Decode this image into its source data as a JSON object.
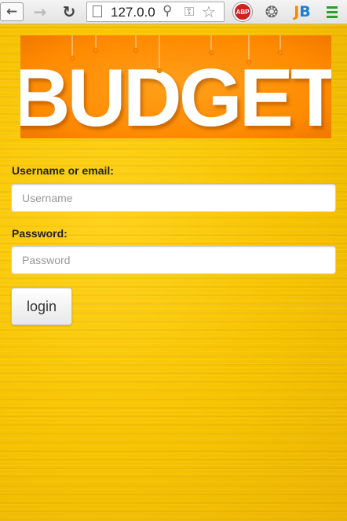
{
  "browser": {
    "url": "127.0.0",
    "extensions": [
      {
        "name": "adblock-plus",
        "label": "ABP"
      },
      {
        "name": "film-reel",
        "label": ""
      },
      {
        "name": "jetbrains",
        "label_j": "J",
        "label_b": "B"
      }
    ]
  },
  "banner": {
    "text": "BUDGET"
  },
  "form": {
    "username_label": "Username or email:",
    "username_placeholder": "Username",
    "password_label": "Password:",
    "password_placeholder": "Password",
    "login_label": "login"
  },
  "colors": {
    "background": "#f5c400",
    "banner": "#ff8a00"
  }
}
